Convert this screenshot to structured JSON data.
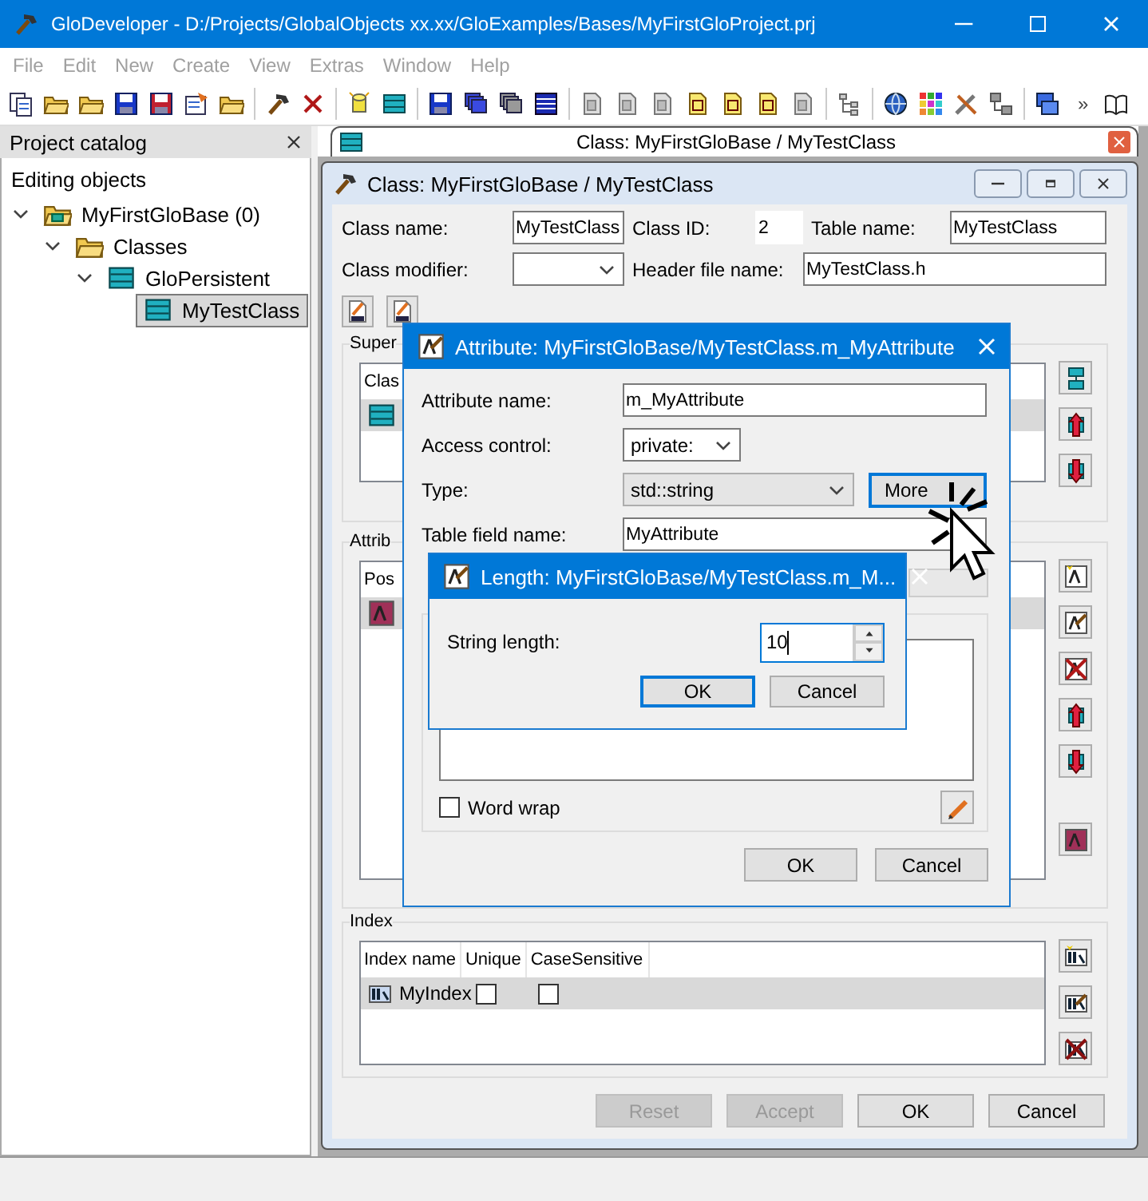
{
  "window": {
    "title": "GloDeveloper - D:/Projects/GlobalObjects xx.xx/GloExamples/Bases/MyFirstGloProject.prj"
  },
  "menu": [
    {
      "label": "File",
      "disabled": true
    },
    {
      "label": "Edit",
      "disabled": true
    },
    {
      "label": "New",
      "disabled": true
    },
    {
      "label": "Create",
      "disabled": true
    },
    {
      "label": "View",
      "disabled": true
    },
    {
      "label": "Extras",
      "disabled": true
    },
    {
      "label": "Window",
      "disabled": true
    },
    {
      "label": "Help",
      "disabled": true
    }
  ],
  "toolbar": {
    "overflow": "»"
  },
  "project_catalog": {
    "title": "Project catalog",
    "section": "Editing objects",
    "tree": [
      {
        "label": "MyFirstGloBase (0)",
        "kind": "database",
        "expanded": true,
        "selected": false,
        "children": [
          {
            "label": "Classes",
            "kind": "folder",
            "expanded": true,
            "selected": false,
            "children": [
              {
                "label": "GloPersistent",
                "kind": "class",
                "expanded": true,
                "selected": false,
                "children": [
                  {
                    "label": "MyTestClass",
                    "kind": "class",
                    "selected": true
                  }
                ]
              }
            ]
          }
        ]
      }
    ]
  },
  "document_tab": {
    "title": "Class: MyFirstGloBase / MyTestClass"
  },
  "class_window": {
    "title": "Class: MyFirstGloBase / MyTestClass",
    "class_name_label": "Class name:",
    "class_name": "MyTestClass",
    "class_id_label": "Class ID:",
    "class_id": "2",
    "table_name_label": "Table name:",
    "table_name": "MyTestClass",
    "class_modifier_label": "Class modifier:",
    "header_file_label": "Header file name:",
    "header_file": "MyTestClass.h",
    "superclasses": {
      "legend": "Super",
      "columns": [
        "Clas"
      ],
      "rows": [
        {
          "kind": "class",
          "selected": true
        }
      ]
    },
    "attributes": {
      "legend": "Attrib",
      "columns": [
        "Pos"
      ],
      "rows": [
        {
          "kind": "attribute",
          "selected": true
        }
      ]
    },
    "indexes": {
      "legend": "Index",
      "columns": [
        "Index name",
        "Unique",
        "CaseSensitive"
      ],
      "rows": [
        {
          "name": "MyIndex",
          "unique": false,
          "case_sensitive": false,
          "selected": true
        }
      ]
    },
    "buttons": [
      {
        "label": "Reset",
        "disabled": true
      },
      {
        "label": "Accept",
        "disabled": true
      },
      {
        "label": "OK",
        "disabled": false
      },
      {
        "label": "Cancel",
        "disabled": false
      }
    ]
  },
  "attribute_dialog": {
    "title": "Attribute: MyFirstGloBase/MyTestClass.m_MyAttribute",
    "attribute_name_label": "Attribute name:",
    "attribute_name": "m_MyAttribute",
    "access_label": "Access control:",
    "access": "private:",
    "type_label": "Type:",
    "type": "std::string",
    "more_button": "More",
    "table_field_label": "Table field name:",
    "table_field": "MyAttribute",
    "word_wrap": {
      "label": "Word wrap",
      "checked": false
    },
    "buttons": [
      "OK",
      "Cancel"
    ]
  },
  "length_dialog": {
    "title": "Length: MyFirstGloBase/MyTestClass.m_M...",
    "string_length_label": "String length:",
    "string_length": "10",
    "buttons": [
      {
        "label": "OK",
        "default": true
      },
      {
        "label": "Cancel",
        "default": false
      }
    ]
  }
}
